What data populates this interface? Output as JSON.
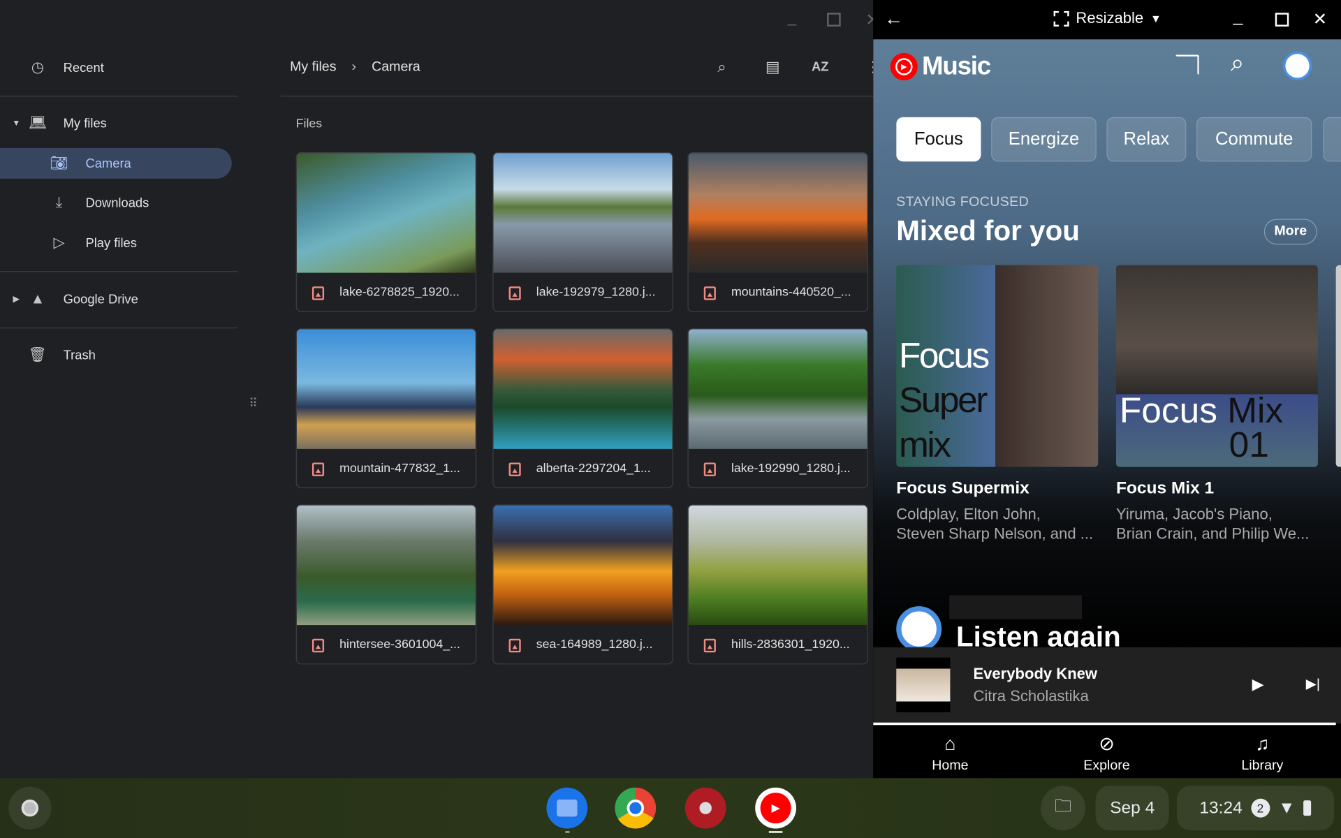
{
  "files_app": {
    "sidebar": {
      "items": [
        {
          "label": "Recent",
          "icon": "clock-icon"
        },
        {
          "label": "My files",
          "icon": "laptop-icon"
        },
        {
          "label": "Camera",
          "icon": "camera-icon",
          "selected": true
        },
        {
          "label": "Downloads",
          "icon": "download-icon"
        },
        {
          "label": "Play files",
          "icon": "play-store-icon"
        },
        {
          "label": "Google Drive",
          "icon": "drive-icon"
        },
        {
          "label": "Trash",
          "icon": "trash-icon"
        }
      ]
    },
    "breadcrumb": [
      "My files",
      "Camera"
    ],
    "section_label": "Files",
    "files": [
      {
        "name": "lake-6278825_1920..."
      },
      {
        "name": "lake-192979_1280.j..."
      },
      {
        "name": "mountains-440520_..."
      },
      {
        "name": "mountain-477832_1..."
      },
      {
        "name": "alberta-2297204_1..."
      },
      {
        "name": "lake-192990_1280.j..."
      },
      {
        "name": "hintersee-3601004_..."
      },
      {
        "name": "sea-164989_1280.j..."
      },
      {
        "name": "hills-2836301_1920..."
      }
    ],
    "toolbar": {
      "sort_label": "AZ"
    }
  },
  "music_app": {
    "titlebar": {
      "mode": "Resizable"
    },
    "logo": "Music",
    "chips": [
      "Focus",
      "Energize",
      "Relax",
      "Commute"
    ],
    "section": {
      "kicker": "STAYING FOCUSED",
      "title": "Mixed for you",
      "more": "More"
    },
    "cards": [
      {
        "title": "Focus Supermix",
        "line1": "Coldplay, Elton John,",
        "line2": "Steven Sharp Nelson, and ...",
        "art_text": [
          "Focus",
          "Super",
          "mix"
        ]
      },
      {
        "title": "Focus Mix 1",
        "line1": "Yiruma, Jacob's Piano,",
        "line2": "Brian Crain, and Philip We...",
        "art_text": [
          "Focus",
          "Mix",
          "01"
        ]
      }
    ],
    "listen_again": "Listen again",
    "now_playing": {
      "title": "Everybody Knew",
      "artist": "Citra Scholastika"
    },
    "nav": [
      "Home",
      "Explore",
      "Library"
    ],
    "accent": "#ff0000"
  },
  "shelf": {
    "date": "Sep 4",
    "time": "13:24",
    "notifications": "2"
  }
}
